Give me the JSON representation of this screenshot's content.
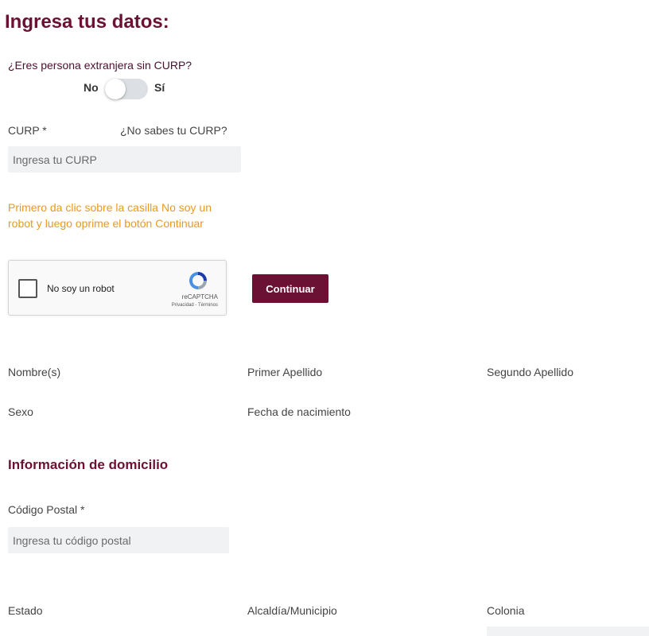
{
  "title": "Ingresa tus datos:",
  "foreign": {
    "question": "¿Eres persona extranjera sin CURP?",
    "no_label": "No",
    "yes_label": "Sí"
  },
  "curp": {
    "label": "CURP *",
    "help_link": "¿No sabes tu CURP?",
    "placeholder": "Ingresa tu CURP"
  },
  "instruction": "Primero da clic sobre la casilla No soy un robot y luego oprime el botón Continuar",
  "captcha": {
    "label": "No soy un robot",
    "brand": "reCAPTCHA",
    "links": "Privacidad - Términos"
  },
  "continue_button": "Continuar",
  "personal": {
    "nombre": "Nombre(s)",
    "primer_apellido": "Primer Apellido",
    "segundo_apellido": "Segundo Apellido",
    "sexo": "Sexo",
    "fecha_nacimiento": "Fecha de nacimiento"
  },
  "address": {
    "section_title": "Información de domicilio",
    "cp_label": "Código Postal *",
    "cp_placeholder": "Ingresa tu código postal",
    "estado": "Estado",
    "municipio": "Alcaldía/Municipio",
    "colonia": "Colonia"
  },
  "colors": {
    "brand": "#6b1133",
    "warning": "#e89a1f",
    "input_bg": "#f1f2f3"
  }
}
